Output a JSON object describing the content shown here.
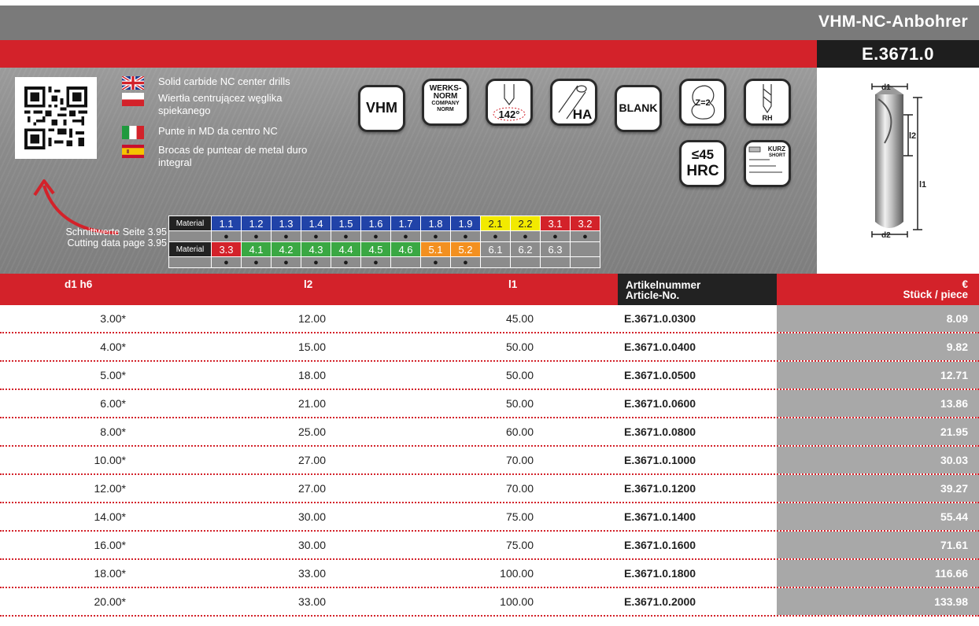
{
  "header": {
    "title": "VHM-NC-Anbohrer",
    "code": "E.3671.0"
  },
  "descriptions": [
    {
      "lang": "en",
      "flag": "uk-flag-icon",
      "text": "Solid carbide NC center drills"
    },
    {
      "lang": "pl",
      "flag": "poland-flag-icon",
      "text": "Wiertła centrującez węglika spiekanego"
    },
    {
      "lang": "it",
      "flag": "italy-flag-icon",
      "text": "Punte in MD da centro NC"
    },
    {
      "lang": "es",
      "flag": "spain-flag-icon",
      "text": "Brocas de puntear de metal duro integral"
    }
  ],
  "icons": {
    "vhm": "VHM",
    "werksnorm": [
      "WERKS-",
      "NORM",
      "COMPANY",
      "NORM"
    ],
    "angle": "142°",
    "ha": "HA",
    "blank": "BLANK",
    "z2": "Z=2",
    "rh": "RH",
    "hrc_top": "≤45",
    "hrc_bottom": "HRC",
    "kurz": "KURZ",
    "short": "SHORT"
  },
  "cutting_data": [
    "Schnittwerte Seite 3.95",
    "Cutting data page  3.95"
  ],
  "material_label": "Material",
  "colors": {
    "blue": "#2143a8",
    "yellow": "#f2ea00",
    "red": "#d3222a",
    "green": "#3aa843",
    "orange": "#f39020",
    "grey": "#8c8c8c"
  },
  "materials_row1": [
    {
      "code": "1.1",
      "color": "blue",
      "dot": "●"
    },
    {
      "code": "1.2",
      "color": "blue",
      "dot": "●"
    },
    {
      "code": "1.3",
      "color": "blue",
      "dot": "●"
    },
    {
      "code": "1.4",
      "color": "blue",
      "dot": "●"
    },
    {
      "code": "1.5",
      "color": "blue",
      "dot": "●"
    },
    {
      "code": "1.6",
      "color": "blue",
      "dot": "●"
    },
    {
      "code": "1.7",
      "color": "blue",
      "dot": "●"
    },
    {
      "code": "1.8",
      "color": "blue",
      "dot": "●"
    },
    {
      "code": "1.9",
      "color": "blue",
      "dot": "●"
    },
    {
      "code": "2.1",
      "color": "yellow",
      "dot": "●"
    },
    {
      "code": "2.2",
      "color": "yellow",
      "dot": "●"
    },
    {
      "code": "3.1",
      "color": "red",
      "dot": "●"
    },
    {
      "code": "3.2",
      "color": "red",
      "dot": "●"
    }
  ],
  "materials_row2": [
    {
      "code": "3.3",
      "color": "red",
      "dot": "●"
    },
    {
      "code": "4.1",
      "color": "green",
      "dot": "●"
    },
    {
      "code": "4.2",
      "color": "green",
      "dot": "●"
    },
    {
      "code": "4.3",
      "color": "green",
      "dot": "●"
    },
    {
      "code": "4.4",
      "color": "green",
      "dot": "●"
    },
    {
      "code": "4.5",
      "color": "green",
      "dot": "●"
    },
    {
      "code": "4.6",
      "color": "green",
      "dot": ""
    },
    {
      "code": "5.1",
      "color": "orange",
      "dot": "●"
    },
    {
      "code": "5.2",
      "color": "orange",
      "dot": "●"
    },
    {
      "code": "6.1",
      "color": "grey",
      "dot": ""
    },
    {
      "code": "6.2",
      "color": "grey",
      "dot": ""
    },
    {
      "code": "6.3",
      "color": "grey",
      "dot": ""
    },
    {
      "code": "",
      "color": "grey",
      "dot": ""
    }
  ],
  "drawing_labels": {
    "d1": "d1",
    "d2": "d2",
    "l1": "l1",
    "l2": "l2"
  },
  "table": {
    "headers": {
      "d1": "d1 h6",
      "l2": "l2",
      "l1": "l1",
      "article": [
        "Artikelnummer",
        "Article-No."
      ],
      "price": [
        "€",
        "Stück / piece"
      ]
    },
    "rows": [
      {
        "d1": "3.00*",
        "l2": "12.00",
        "l1": "45.00",
        "article": "E.3671.0.0300",
        "price": "8.09"
      },
      {
        "d1": "4.00*",
        "l2": "15.00",
        "l1": "50.00",
        "article": "E.3671.0.0400",
        "price": "9.82"
      },
      {
        "d1": "5.00*",
        "l2": "18.00",
        "l1": "50.00",
        "article": "E.3671.0.0500",
        "price": "12.71"
      },
      {
        "d1": "6.00*",
        "l2": "21.00",
        "l1": "50.00",
        "article": "E.3671.0.0600",
        "price": "13.86"
      },
      {
        "d1": "8.00*",
        "l2": "25.00",
        "l1": "60.00",
        "article": "E.3671.0.0800",
        "price": "21.95"
      },
      {
        "d1": "10.00*",
        "l2": "27.00",
        "l1": "70.00",
        "article": "E.3671.0.1000",
        "price": "30.03"
      },
      {
        "d1": "12.00*",
        "l2": "27.00",
        "l1": "70.00",
        "article": "E.3671.0.1200",
        "price": "39.27"
      },
      {
        "d1": "14.00*",
        "l2": "30.00",
        "l1": "75.00",
        "article": "E.3671.0.1400",
        "price": "55.44"
      },
      {
        "d1": "16.00*",
        "l2": "30.00",
        "l1": "75.00",
        "article": "E.3671.0.1600",
        "price": "71.61"
      },
      {
        "d1": "18.00*",
        "l2": "33.00",
        "l1": "100.00",
        "article": "E.3671.0.1800",
        "price": "116.66"
      },
      {
        "d1": "20.00*",
        "l2": "33.00",
        "l1": "100.00",
        "article": "E.3671.0.2000",
        "price": "133.98"
      }
    ]
  }
}
